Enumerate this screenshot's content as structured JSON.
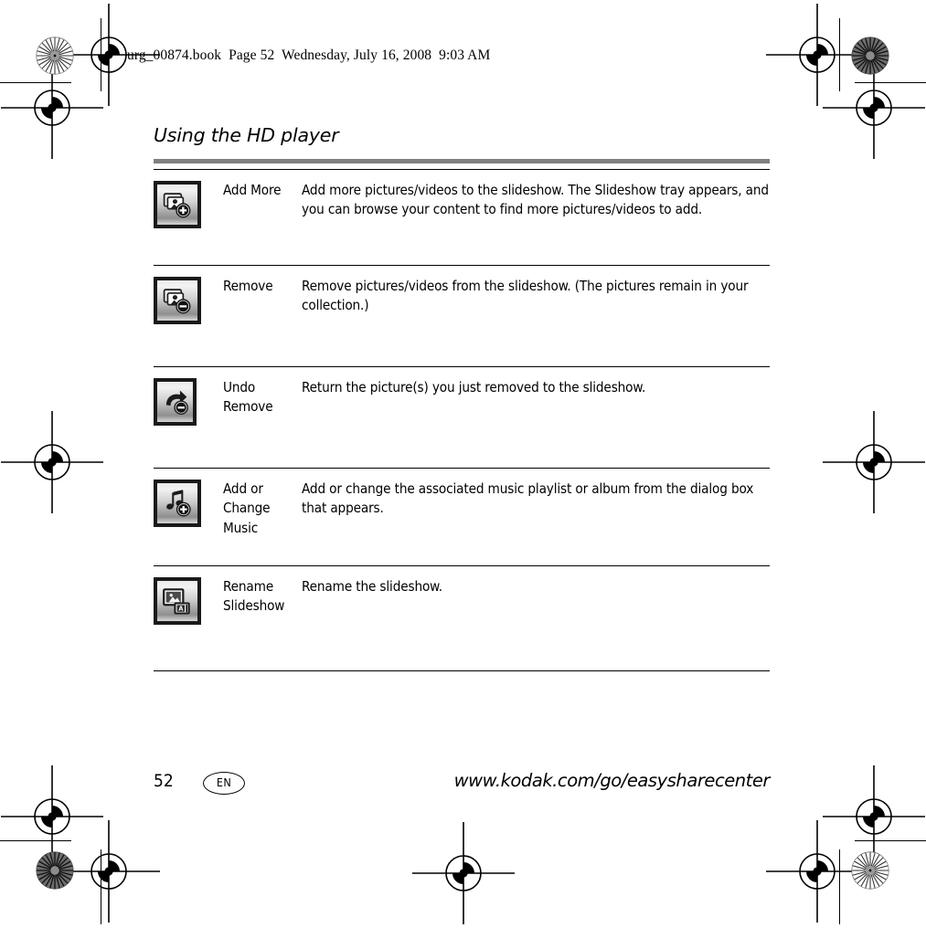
{
  "print_marks": {
    "file_header": "urg_00874.book  Page 52  Wednesday, July 16, 2008  9:03 AM",
    "registration_icon": "registration-target-icon",
    "star_target_icon": "star-density-target-icon"
  },
  "page": {
    "title": "Using the HD player",
    "footer": {
      "page_number": "52",
      "language_code": "EN",
      "url": "www.kodak.com/go/easysharecenter"
    }
  },
  "icon_table": {
    "rows": [
      {
        "icon": "add-more-pictures-icon",
        "name": "Add More",
        "description": "Add more pictures/videos to the slideshow. The Slideshow tray appears, and you can browse your content to find more pictures/videos to add."
      },
      {
        "icon": "remove-pictures-icon",
        "name": "Remove",
        "description": "Remove pictures/videos from the slideshow. (The pictures remain in your collection.)"
      },
      {
        "icon": "undo-remove-icon",
        "name": "Undo\nRemove",
        "description": "Return the picture(s) you just removed to the slideshow."
      },
      {
        "icon": "add-change-music-icon",
        "name": "Add or\nChange\nMusic",
        "description": "Add or change the associated music playlist or album from the dialog box that appears."
      },
      {
        "icon": "rename-slideshow-icon",
        "name": "Rename\nSlideshow",
        "description": "Rename the slideshow."
      }
    ]
  },
  "colors": {
    "title_rule": "#808080",
    "table_rule": "#000000",
    "icon_border": "#1a1a1a",
    "page_background": "#ffffff"
  }
}
